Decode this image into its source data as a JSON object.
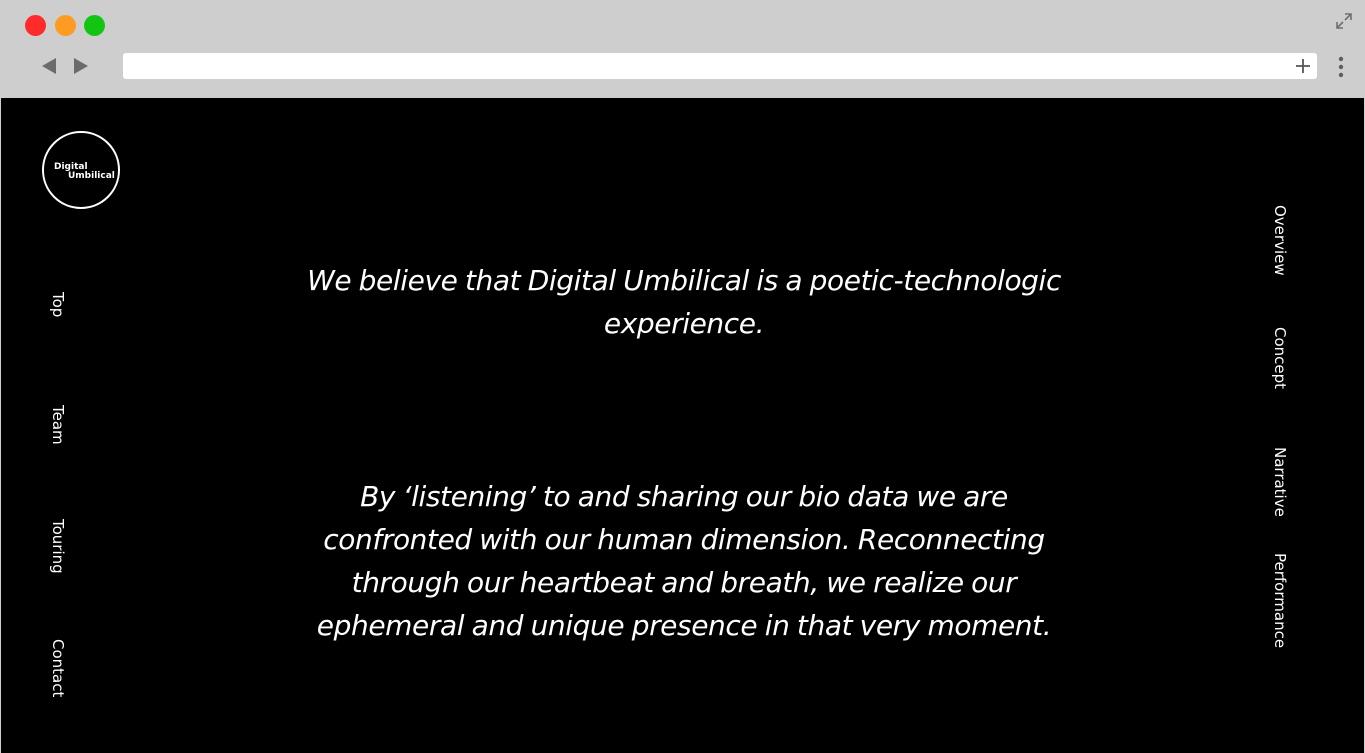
{
  "browser": {
    "colors": {
      "chrome": "#cecece",
      "close": "#ff2a2a",
      "minimize": "#ff9a22",
      "maximize": "#13c512"
    },
    "icons": {
      "back": "back-arrow-icon",
      "forward": "forward-arrow-icon",
      "new_tab": "plus-icon",
      "menu": "kebab-menu-icon",
      "fullscreen": "expand-icon"
    },
    "address_bar": {
      "value": "",
      "placeholder": ""
    }
  },
  "page": {
    "background": "#000000",
    "text_color": "#ffffff",
    "logo": {
      "line1": "Digital",
      "line2": "Umbilical"
    },
    "left_nav": [
      {
        "label": "Top"
      },
      {
        "label": "Team"
      },
      {
        "label": "Touring"
      },
      {
        "label": "Contact"
      }
    ],
    "right_nav": [
      {
        "label": "Overview"
      },
      {
        "label": "Concept"
      },
      {
        "label": "Narrative"
      },
      {
        "label": "Performance"
      }
    ],
    "statement_1": "We believe that Digital Umbilical is a poetic-technologic experience.",
    "statement_2": "By ‘listening’ to and sharing our bio data we are confronted with our human dimension. Reconnecting through our heartbeat and breath, we realize our ephemeral and unique presence in that very moment."
  }
}
